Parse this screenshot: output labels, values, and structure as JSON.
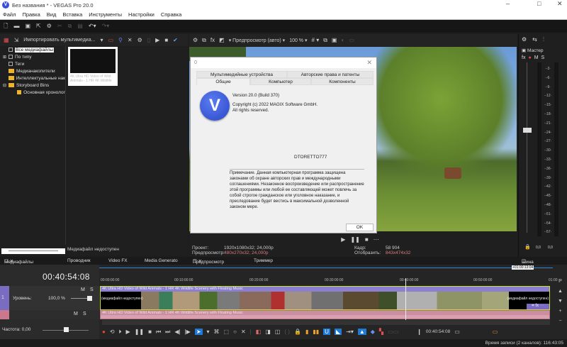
{
  "window": {
    "title": "Без названия * - VEGAS Pro 20.0",
    "logo_letter": "V"
  },
  "menu": [
    "Файл",
    "Правка",
    "Вид",
    "Вставка",
    "Инструменты",
    "Настройки",
    "Справка"
  ],
  "media_panel": {
    "import_label": "Импортировать мультимедиа...",
    "tree": [
      "Все медиафайлы",
      "По типу",
      "Теги",
      "Медианакопители",
      "Интеллектуальные нак",
      "Storyboard Bins",
      "Основная хронолог"
    ],
    "thumb_caption": "4K Ultra HD Video of Wild Animals - 1 HR 4K Wildlife",
    "unavailable": "Медиафайл недоступен"
  },
  "preview": {
    "mode_label": "Предпросмотр (авто)",
    "zoom_label": "100 %",
    "project_label": "Проект:",
    "project_value": "1920x1080x32; 24,000p",
    "preview_label": "Предпросмотр:",
    "preview_value": "480x270x32; 24,000p",
    "frame_label": "Кадр:",
    "frame_value": "58 904",
    "display_label": "Отобразить:",
    "display_value": "843x474x32"
  },
  "dialog": {
    "title": "0",
    "tabs_row1": [
      "Мультимедийные устройства",
      "Авторские права и патенты"
    ],
    "tabs_row2": [
      "Общие",
      "Компьютер",
      "Компоненты"
    ],
    "version": "Version 20.0 (Build 370)",
    "copyright": "Copyright (c) 2022 MAGIX Software GmbH.",
    "rights": "All rights reserved.",
    "user": "DTORETTO777",
    "notice": "Примечание. Данная компьютерная программа защищена законами об охране авторских прав и международными соглашениями. Незаконное воспроизведение или распространение этой программы или любой ее составляющей может повлечь за собой строгое гражданское или уголовное наказание, и преследование будет вестись в максимальной дозволенной законом мере.",
    "ok": "OK"
  },
  "mixer": {
    "master": "Мастер",
    "fx": "fx",
    "m": "M",
    "s": "S",
    "marks": [
      "-3",
      "-6",
      "-9",
      "-12",
      "-15",
      "-18",
      "-21",
      "-24",
      "-27",
      "-30",
      "-33",
      "-36",
      "-39",
      "-42",
      "-45",
      "-48",
      "-51",
      "-54",
      "-57"
    ],
    "left_val": "0,0",
    "right_val": "0,0",
    "bus_label": "Шина мастеринга"
  },
  "tabs": {
    "project_media": "Медиафайлы проекта",
    "explorer": "Проводник",
    "video_fx": "Video FX",
    "media_gen": "Media Generato",
    "video_preview": "Предпросмотр видео",
    "trimmer": "Триммер"
  },
  "timeline": {
    "timecode": "00:40:54:08",
    "ruler": [
      "00:00:00:00",
      "00:10:00:00",
      "00:20:00:00",
      "00:30:00:00",
      "00:40:00:00",
      "00:50:00:00",
      "01:00"
    ],
    "loop_end": "+01:00:13:04",
    "video_track": {
      "num": "1",
      "level_label": "Уровень:",
      "level_value": "100,0 %",
      "m": "M",
      "s": "S"
    },
    "audio_track": {
      "m": "M",
      "s": "S"
    },
    "clip_title": "4K Ultra HD Video of Wild Animals - 1 HR 4K Wildlife Scenery with Floating Music",
    "clip_offline": "(медиафайл недоступен)",
    "rate_label": "Частота: 0,00",
    "cursor_time": "00:40:54:08"
  },
  "status": {
    "record_time": "Время записи (2 каналов): 116:43:05"
  }
}
